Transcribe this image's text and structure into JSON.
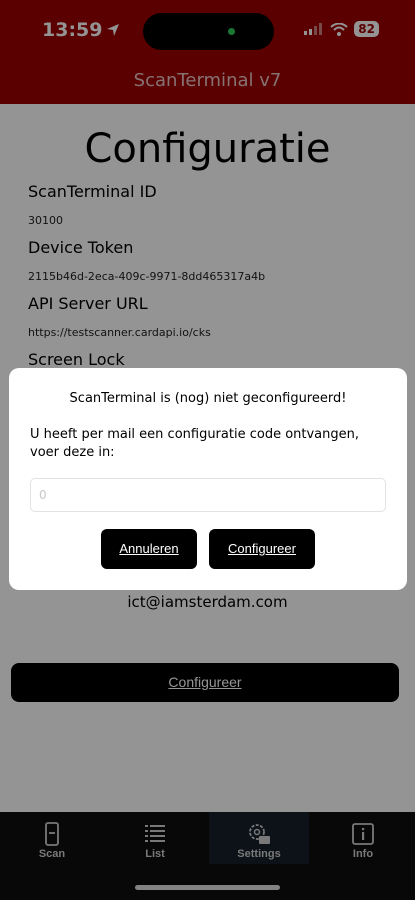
{
  "status_bar": {
    "time": "13:59",
    "battery": "82"
  },
  "header": {
    "title": "ScanTerminal v7"
  },
  "page": {
    "title": "Configuratie",
    "fields": [
      {
        "label": "ScanTerminal ID",
        "value": "30100"
      },
      {
        "label": "Device Token",
        "value": "2115b46d-2eca-409c-9971-8dd465317a4b"
      },
      {
        "label": "API Server URL",
        "value": "https://testscanner.cardapi.io/cks"
      },
      {
        "label": "Screen Lock",
        "value": ""
      }
    ],
    "contact_email": "ict@iamsterdam.com",
    "configure_button": "Configureer"
  },
  "dialog": {
    "title": "ScanTerminal is (nog) niet geconfigureerd!",
    "message": "U heeft per mail een configuratie code ontvangen, voer deze in:",
    "input_placeholder": "0",
    "cancel_button": "Annuleren",
    "confirm_button": "Configureer"
  },
  "tabs": [
    {
      "label": "Scan",
      "icon": "phone-scan-icon",
      "active": false
    },
    {
      "label": "List",
      "icon": "list-icon",
      "active": false
    },
    {
      "label": "Settings",
      "icon": "settings-gear-icon",
      "active": true
    },
    {
      "label": "Info",
      "icon": "info-icon",
      "active": false
    }
  ],
  "colors": {
    "header": "#9c0000",
    "tab_bar": "#0e0e0e",
    "active_tab": "#16202a",
    "button": "#000000"
  }
}
